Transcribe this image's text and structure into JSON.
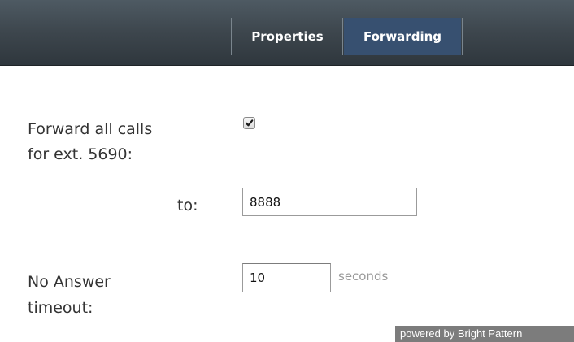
{
  "tabs": {
    "properties": "Properties",
    "forwarding": "Forwarding",
    "active": "Forwarding"
  },
  "forward_all": {
    "label_line1": "Forward all calls",
    "label_line2": "for ext. 5690:",
    "checked": true
  },
  "forward_to": {
    "label": "to:",
    "value": "8888"
  },
  "no_answer": {
    "label_line1": "No Answer",
    "label_line2": "timeout:",
    "value": "10",
    "unit": "seconds"
  },
  "footer": {
    "text": "powered by Bright Pattern"
  },
  "colors": {
    "tab_bar": "#3d464d",
    "active_tab": "#375070",
    "footer_bg": "#7c7c7c"
  },
  "icons": {
    "checkbox_mark": "checkmark-icon"
  }
}
